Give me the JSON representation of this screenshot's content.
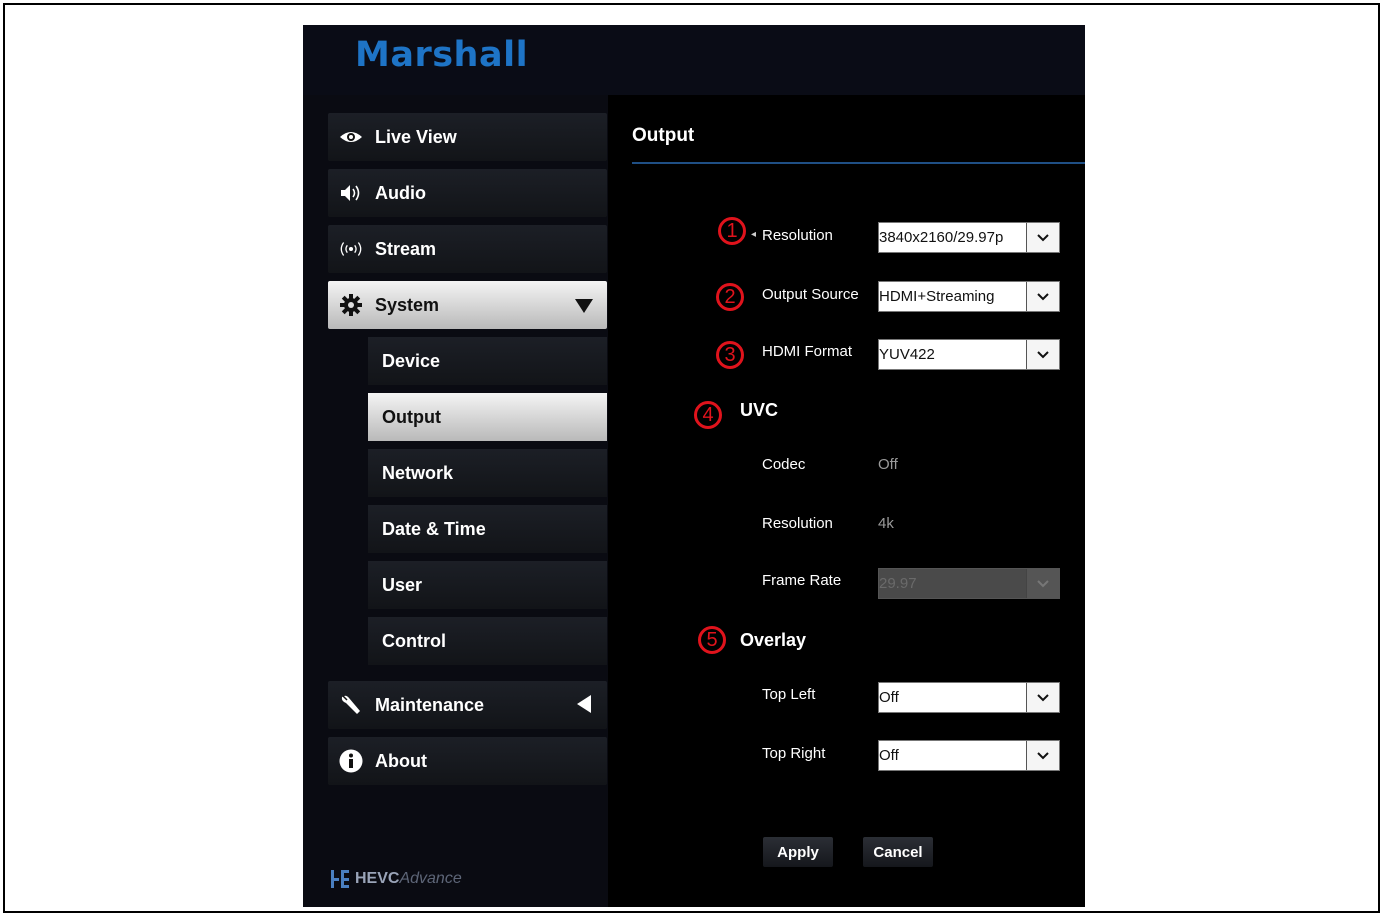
{
  "brand": {
    "logo_text": "Marshall",
    "footer_badge_prefix": "HEVC",
    "footer_badge_suffix": "Advance"
  },
  "sidebar": {
    "items": [
      {
        "label": "Live View",
        "icon": "eye-icon"
      },
      {
        "label": "Audio",
        "icon": "speaker-icon"
      },
      {
        "label": "Stream",
        "icon": "broadcast-icon"
      },
      {
        "label": "System",
        "icon": "gear-icon",
        "expanded": true
      },
      {
        "label": "Maintenance",
        "icon": "wrench-icon"
      },
      {
        "label": "About",
        "icon": "info-icon"
      }
    ],
    "system_sub_items": [
      {
        "label": "Device"
      },
      {
        "label": "Output",
        "active": true
      },
      {
        "label": "Network"
      },
      {
        "label": "Date & Time"
      },
      {
        "label": "User"
      },
      {
        "label": "Control"
      }
    ]
  },
  "main": {
    "title": "Output",
    "fields": {
      "resolution": {
        "label": "Resolution",
        "value": "3840x2160/29.97p"
      },
      "output_source": {
        "label": "Output Source",
        "value": "HDMI+Streaming"
      },
      "hdmi_format": {
        "label": "HDMI Format",
        "value": "YUV422"
      }
    },
    "uvc": {
      "heading": "UVC",
      "codec": {
        "label": "Codec",
        "value": "Off"
      },
      "resolution": {
        "label": "Resolution",
        "value": "4k"
      },
      "frame_rate": {
        "label": "Frame Rate",
        "value": "29.97"
      }
    },
    "overlay": {
      "heading": "Overlay",
      "top_left": {
        "label": "Top Left",
        "value": "Off"
      },
      "top_right": {
        "label": "Top Right",
        "value": "Off"
      }
    },
    "buttons": {
      "apply": "Apply",
      "cancel": "Cancel"
    },
    "markers": [
      "1",
      "2",
      "3",
      "4",
      "5"
    ]
  },
  "colors": {
    "accent": "#1e74c6",
    "marker": "#e0131c",
    "rule": "#1f4f85"
  }
}
